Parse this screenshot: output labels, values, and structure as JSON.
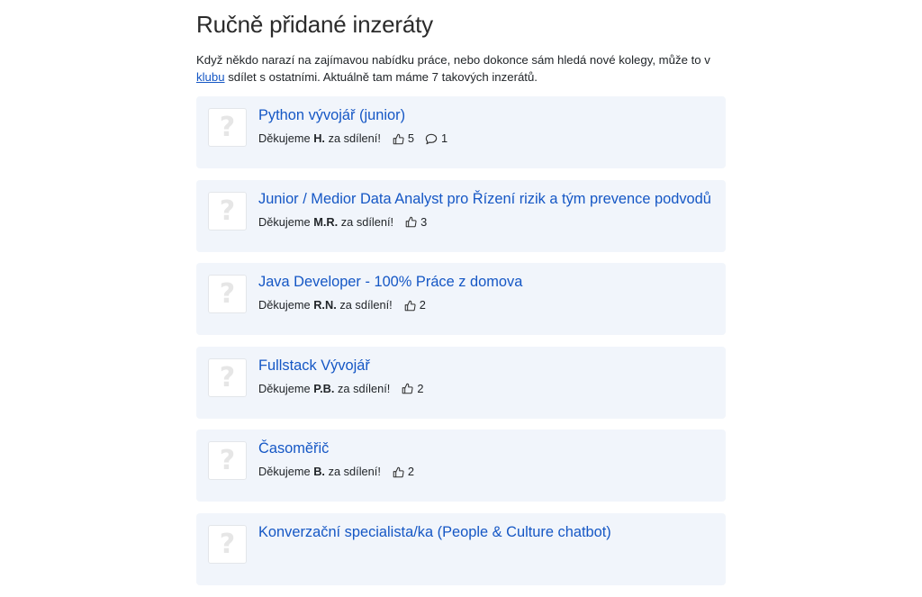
{
  "heading": "Ručně přidané inzeráty",
  "intro": {
    "before": "Když někdo narazí na zajímavou nabídku práce, nebo dokonce sám hledá nové kolegy, může to v ",
    "link": "klubu",
    "after": " sdí­let s ostatními. Aktuálně tam máme 7 takových inzerátů."
  },
  "jobs": [
    {
      "title": "Python vývojář (junior)",
      "thanks_prefix": "Děkujeme",
      "author": "H.",
      "thanks_suffix": "za sdílení!",
      "likes": "5",
      "comments": "1",
      "logo_icon": "placeholder-question-icon"
    },
    {
      "title": "Junior / Medior Data Analyst pro Řízení rizik a tým prevence podvodů",
      "thanks_prefix": "Děkujeme",
      "author": "M.R.",
      "thanks_suffix": "za sdílení!",
      "likes": "3",
      "logo_icon": "placeholder-question-icon"
    },
    {
      "title": "Java Developer - 100% Práce z domova",
      "thanks_prefix": "Děkujeme",
      "author": "R.N.",
      "thanks_suffix": "za sdílení!",
      "likes": "2",
      "logo_icon": "placeholder-question-icon"
    },
    {
      "title": "Fullstack Vývojář",
      "thanks_prefix": "Děkujeme",
      "author": "P.B.",
      "thanks_suffix": "za sdílení!",
      "likes": "2",
      "logo_icon": "placeholder-question-icon"
    },
    {
      "title": "Časoměřič",
      "thanks_prefix": "Děkujeme",
      "author": "B.",
      "thanks_suffix": "za sdílení!",
      "likes": "2",
      "logo_icon": "placeholder-question-icon"
    },
    {
      "title": "Konverzační specialista/ka (People & Culture chatbot)",
      "logo_icon": "placeholder-question-icon"
    }
  ],
  "colors": {
    "link": "#1557c5",
    "card_background": "#f1f5fb"
  }
}
